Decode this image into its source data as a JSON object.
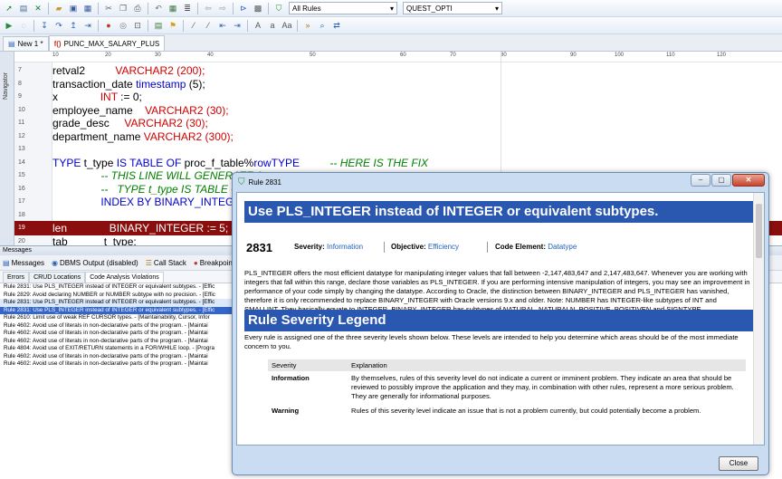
{
  "toolbar": {
    "rules_filter": "All Rules",
    "connection": "QUEST_OPTI"
  },
  "doc_tabs": [
    {
      "label": "New 1 *"
    },
    {
      "label": "PUNC_MAX_SALARY_PLUS"
    }
  ],
  "navigator_label": "Navigator",
  "ruler_ticks": [
    "10",
    "20",
    "30",
    "40",
    "50",
    "60",
    "70",
    "80",
    "90",
    "100",
    "110",
    "120"
  ],
  "editor": {
    "lines": [
      {
        "num": "7",
        "parts": [
          [
            "",
            "retval2          "
          ],
          [
            "ty",
            "VARCHAR2 (200);"
          ]
        ]
      },
      {
        "num": "8",
        "parts": [
          [
            "",
            "transaction_date "
          ],
          [
            "kw",
            "timestamp"
          ],
          [
            "",
            " (5);"
          ]
        ]
      },
      {
        "num": "9",
        "parts": [
          [
            "",
            "x              "
          ],
          [
            "ty",
            "INT"
          ],
          [
            "",
            " := 0;"
          ]
        ]
      },
      {
        "num": "10",
        "parts": [
          [
            "",
            "employee_name    "
          ],
          [
            "ty",
            "VARCHAR2 (30);"
          ]
        ]
      },
      {
        "num": "11",
        "parts": [
          [
            "",
            "grade_desc     "
          ],
          [
            "ty",
            "VARCHAR2 (30);"
          ]
        ]
      },
      {
        "num": "12",
        "parts": [
          [
            "",
            "department_name "
          ],
          [
            "ty",
            "VARCHAR2 (300);"
          ]
        ]
      },
      {
        "num": "13",
        "parts": [
          [
            "",
            ""
          ]
        ]
      },
      {
        "num": "14",
        "parts": [
          [
            "kw",
            "TYPE"
          ],
          [
            "",
            " t_type "
          ],
          [
            "kw",
            "IS TABLE OF"
          ],
          [
            "",
            " proc_f_table%"
          ],
          [
            "kw",
            "rowTYPE"
          ],
          [
            "cm",
            "          -- HERE IS THE FIX"
          ]
        ]
      },
      {
        "num": "15",
        "parts": [
          [
            "cm",
            "                -- THIS LINE WILL GENERATE A"
          ]
        ]
      },
      {
        "num": "16",
        "parts": [
          [
            "cm",
            "                --   TYPE t_type IS TABLE OF pro"
          ]
        ]
      },
      {
        "num": "17",
        "parts": [
          [
            "",
            "                "
          ],
          [
            "kw",
            "INDEX BY BINARY_INTEGER"
          ],
          [
            "",
            ";"
          ]
        ]
      },
      {
        "num": "18",
        "parts": [
          [
            "",
            ""
          ]
        ]
      },
      {
        "num": "19",
        "parts": [
          [
            "",
            "len              BINARY_INTEGER := 5;"
          ]
        ]
      },
      {
        "num": "20",
        "parts": [
          [
            "",
            "tab            t_type;"
          ]
        ]
      }
    ]
  },
  "messages_panel": {
    "title": "Messages",
    "tabs": [
      "Messages",
      "DBMS Output (disabled)",
      "Call Stack",
      "Breakpoints"
    ],
    "subtabs": [
      "Errors",
      "CRUD Locations",
      "Code Analysis Violations"
    ],
    "rules": [
      "Rule 2831: Use PLS_INTEGER instead of INTEGER or equivalent subtypes. - [Effic",
      "Rule 2829: Avoid declaring NUMBER or NUMBER subtype with no precision. - [Effic",
      "Rule 2831: Use PLS_INTEGER instead of INTEGER or equivalent subtypes. - [Effic",
      "Rule 2831: Use PLS_INTEGER instead of INTEGER or equivalent subtypes. - [Effic",
      "Rule 2610: Limit use of weak REF CURSOR types. - [Maintainability, Cursor, Infor",
      "Rule 4602: Avoid use of literals in non-declarative parts of the program. - [Maintai",
      "Rule 4602: Avoid use of literals in non-declarative parts of the program. - [Maintai",
      "Rule 4602: Avoid use of literals in non-declarative parts of the program. - [Maintai",
      "Rule 4804: Avoid use of EXIT/RETURN statements in a FOR/WHILE loop. - [Progra",
      "Rule 4602: Avoid use of literals in non-declarative parts of the program. - [Maintai",
      "Rule 4602: Avoid use of literals in non-declarative parts of the program. - [Maintai"
    ],
    "selected_index": 3
  },
  "dialog": {
    "title": "Rule 2831",
    "heading": "Use PLS_INTEGER instead of INTEGER or equivalent subtypes.",
    "rule_number": "2831",
    "severity_label": "Severity:",
    "severity_value": "Information",
    "objective_label": "Objective:",
    "objective_value": "Efficiency",
    "code_element_label": "Code Element:",
    "code_element_value": "Datatype",
    "description": "PLS_INTEGER offers the most efficient datatype for manipulating integer values that fall between -2,147,483,647 and 2,147,483,647. Whenever you are working with integers that fall within this range, declare those variables as PLS_INTEGER. If you are performing intensive manipulation of integers, you may see an improvement in performance of your code simply by changing the datatype. According to Oracle, the distinction between BINARY_INTEGER and PLS_INTEGER has vanished, therefore it is only recommended to replace BINARY_INTEGER with Oracle versions 9.x and older. Note: NUMBER has INTEGER-like subtypes of INT and SMALLINT. They basically equate to INTEGER. BINARY_INTEGER has subtypes of NATURAL, NATURALN, POSITIVE, POSITIVEN and SIGNTYPE.",
    "legend_heading": "Rule Severity Legend",
    "legend_text": "Every rule is assigned one of the three severity levels shown below. These levels are intended to help you determine which areas should be of the most immediate concern to you.",
    "table_headers": [
      "Severity",
      "Explanation"
    ],
    "table_rows": [
      {
        "severity": "Information",
        "explanation": "By themselves, rules of this severity level do not indicate a current or imminent problem. They indicate an area that should be reviewed to possibly improve the application and they may, in combination with other rules, represent a more serious problem. They are generally for informational purposes."
      },
      {
        "severity": "Warning",
        "explanation": "Rules of this severity level indicate an issue that is not a problem currently, but could potentially become a problem."
      }
    ],
    "close_label": "Close"
  },
  "colors": {
    "heading_bar": "#2a57b0",
    "highlight_line": "#8b0e0e",
    "keyword": "#0000cc",
    "type": "#d00000",
    "comment": "#008000"
  }
}
